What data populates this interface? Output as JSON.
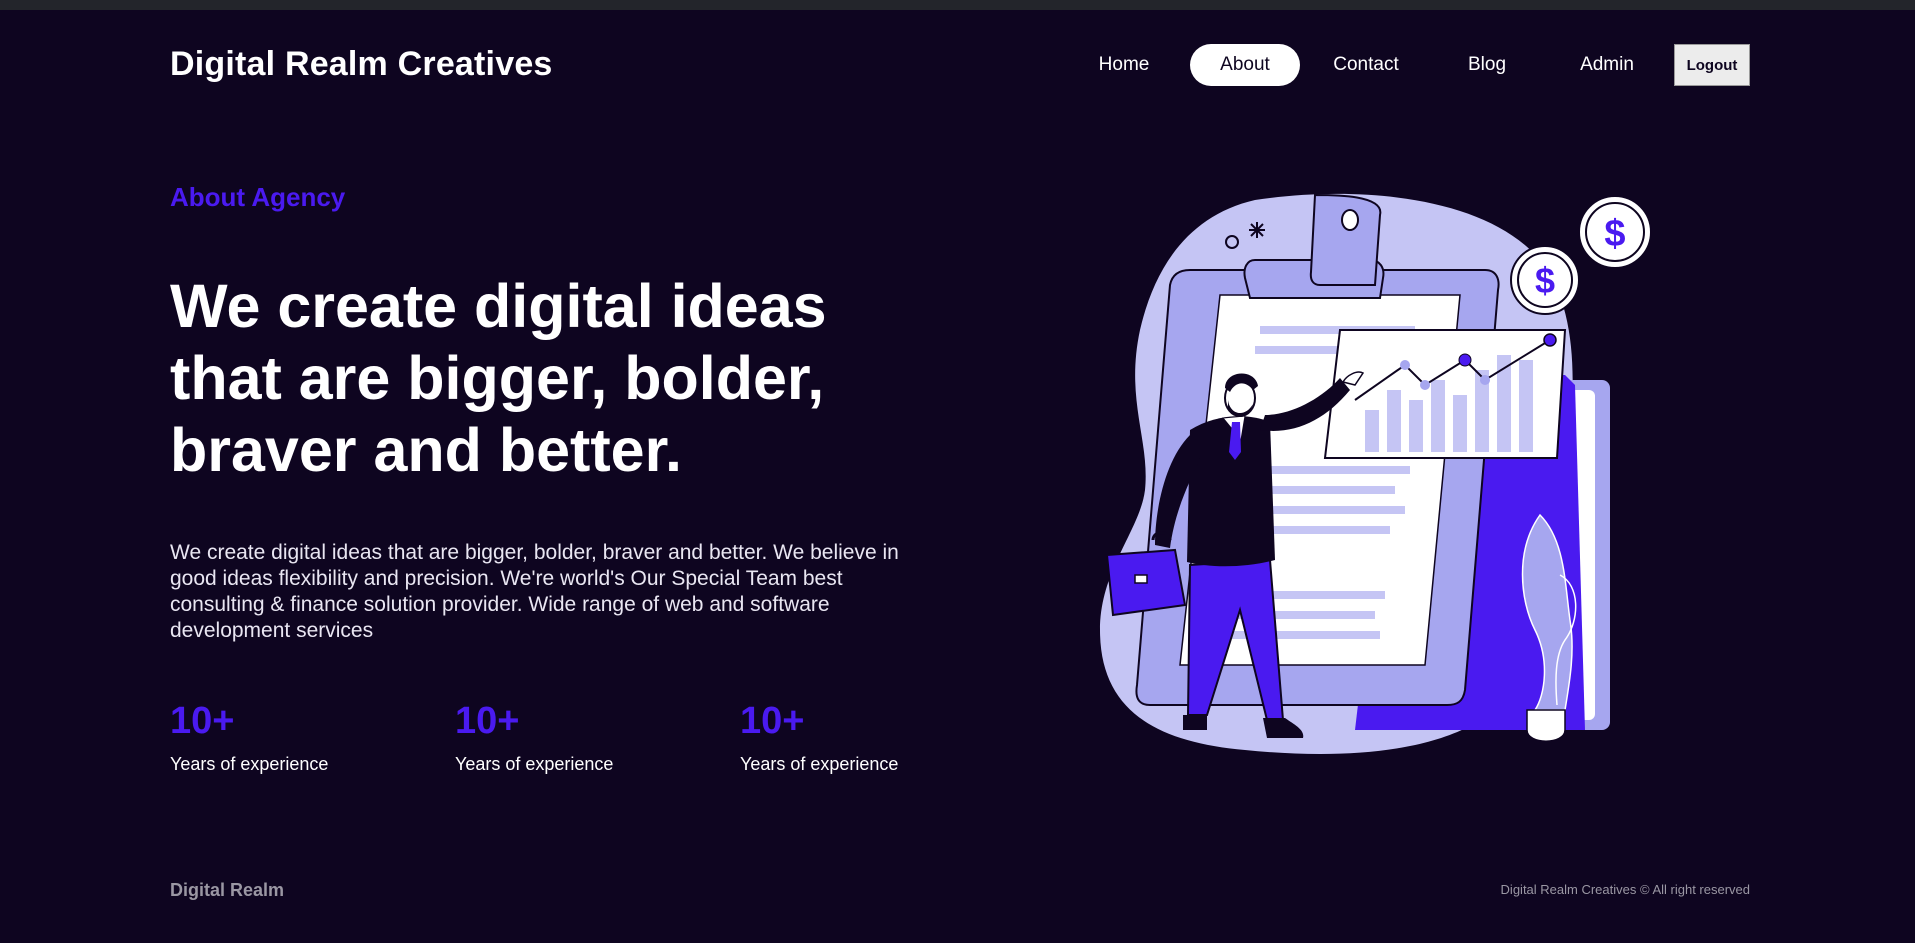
{
  "header": {
    "brand": "Digital Realm Creatives",
    "nav": [
      {
        "label": "Home",
        "active": false
      },
      {
        "label": "About",
        "active": true
      },
      {
        "label": "Contact",
        "active": false
      },
      {
        "label": "Blog",
        "active": false
      },
      {
        "label": "Admin",
        "active": false
      }
    ],
    "logout_label": "Logout"
  },
  "hero": {
    "eyebrow": "About Agency",
    "headline": "We create digital ideas that are bigger, bolder, braver and better.",
    "description": "We create digital ideas that are bigger, bolder, braver and better. We believe in good ideas flexibility and precision. We're world's Our Special Team best consulting & finance solution provider. Wide range of web and software development services",
    "stats": [
      {
        "value": "10+",
        "label": "Years of experience"
      },
      {
        "value": "10+",
        "label": "Years of experience"
      },
      {
        "value": "10+",
        "label": "Years of experience"
      }
    ]
  },
  "illustration": {
    "icon": "businessman-presenting-chart-illustration",
    "coin_symbol": "$"
  },
  "footer": {
    "brand": "Digital Realm",
    "copyright": "Digital Realm Creatives © All right reserved"
  },
  "colors": {
    "background": "#0e0520",
    "accent": "#4a1af0",
    "text": "#ffffff",
    "muted": "#9a97a3"
  }
}
